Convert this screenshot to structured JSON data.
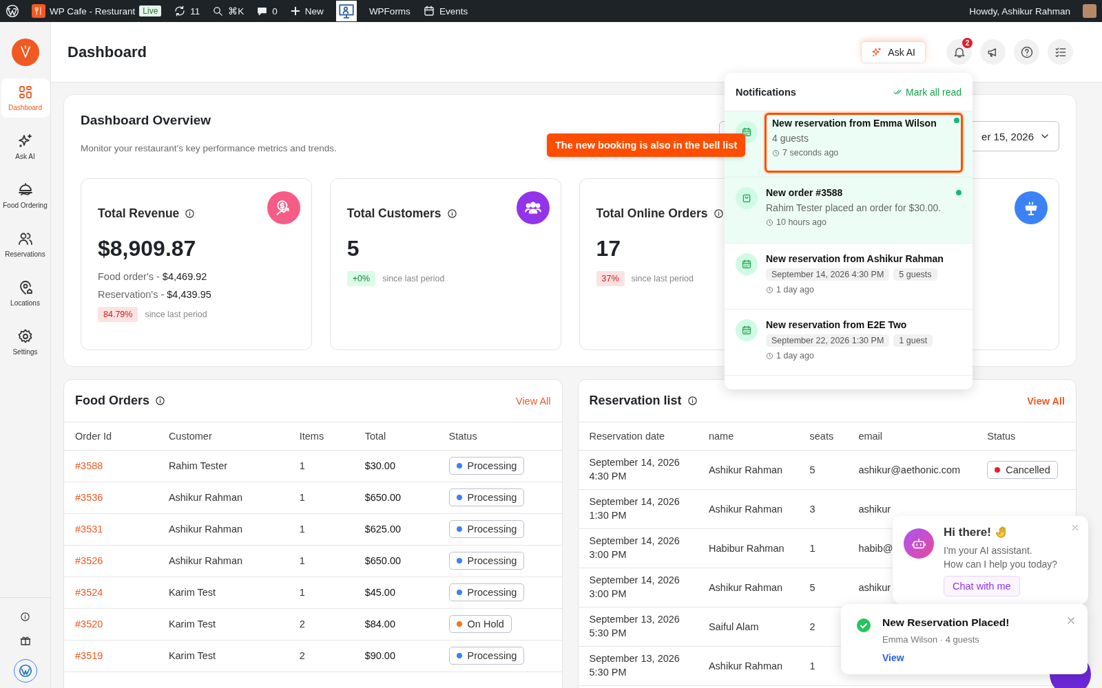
{
  "top_bar": {
    "site_name": "WP Cafe - Resturant",
    "live_badge": "Live",
    "updates": "11",
    "search_shortcut": "⌘K",
    "comments": "0",
    "new_label": "New",
    "links": [
      "WPForms",
      "Events"
    ],
    "greeting": "Howdy, Ashikur Rahman"
  },
  "sidebar": {
    "items": [
      {
        "kind": "dashboard",
        "label": "Dashboard",
        "selected": true
      },
      {
        "kind": "ai",
        "label": "Ask AI",
        "selected": false
      },
      {
        "kind": "food",
        "label": "Food Ordering",
        "selected": false
      },
      {
        "kind": "reservations",
        "label": "Reservations",
        "selected": false
      },
      {
        "kind": "locations",
        "label": "Locations",
        "selected": false
      },
      {
        "kind": "settings",
        "label": "Settings",
        "selected": false
      }
    ]
  },
  "header": {
    "title": "Dashboard",
    "ask_ai": "Ask AI",
    "notification_count": "2"
  },
  "overview": {
    "title": "Dashboard Overview",
    "subtitle": "Monitor your restaurant's key performance metrics and trends.",
    "date_range": "er 15, 2026",
    "stats": [
      {
        "kind": "revenue",
        "title": "Total Revenue",
        "value": "$8,909.87",
        "breakdown": [
          {
            "label": "Food order's -",
            "amount": "$4,469.92"
          },
          {
            "label": "Reservation's -",
            "amount": "$4,439.95"
          }
        ],
        "change": "84.79%",
        "positive": false,
        "note": "since last period",
        "color": "#f75c86"
      },
      {
        "kind": "customers",
        "title": "Total Customers",
        "value": "5",
        "change": "+0%",
        "positive": true,
        "note": "since last period",
        "color": "#9333ea"
      },
      {
        "title": "Total Online Orders",
        "value": "17",
        "change": "37%",
        "positive": false,
        "note": "since last period"
      },
      {
        "kind": "reservations",
        "color": "#3b82f6"
      }
    ]
  },
  "food_orders": {
    "title": "Food Orders",
    "view_all": "View All",
    "columns": [
      "Order Id",
      "Customer",
      "Items",
      "Total",
      "Status"
    ],
    "rows": [
      {
        "id": "#3588",
        "customer": "Rahim Tester",
        "items": "1",
        "total": "$30.00",
        "status": {
          "label": "Processing",
          "color": "#3b82f6"
        }
      },
      {
        "id": "#3536",
        "customer": "Ashikur Rahman",
        "items": "1",
        "total": "$650.00",
        "status": {
          "label": "Processing",
          "color": "#3b82f6"
        }
      },
      {
        "id": "#3531",
        "customer": "Ashikur Rahman",
        "items": "1",
        "total": "$625.00",
        "status": {
          "label": "Processing",
          "color": "#3b82f6"
        }
      },
      {
        "id": "#3526",
        "customer": "Ashikur Rahman",
        "items": "1",
        "total": "$650.00",
        "status": {
          "label": "Processing",
          "color": "#3b82f6"
        }
      },
      {
        "id": "#3524",
        "customer": "Karim Test",
        "items": "1",
        "total": "$45.00",
        "status": {
          "label": "Processing",
          "color": "#3b82f6"
        }
      },
      {
        "id": "#3520",
        "customer": "Karim Test",
        "items": "2",
        "total": "$84.00",
        "status": {
          "label": "On Hold",
          "color": "#f97316"
        }
      },
      {
        "id": "#3519",
        "customer": "Karim Test",
        "items": "2",
        "total": "$90.00",
        "status": {
          "label": "Processing",
          "color": "#3b82f6"
        }
      }
    ]
  },
  "reservations": {
    "title": "Reservation list",
    "view_all": "View All",
    "columns": [
      "Reservation date",
      "name",
      "seats",
      "email",
      "Status"
    ],
    "rows": [
      {
        "date": "September 14, 2026",
        "time": "4:30 PM",
        "name": "Ashikur Rahman",
        "seats": "5",
        "email": "ashikur@aethonic.com",
        "status": {
          "label": "Cancelled",
          "color": "#ef1c2c"
        }
      },
      {
        "date": "September 14, 2026",
        "time": "1:30 PM",
        "name": "Ashikur Rahman",
        "seats": "3",
        "email": "ashikur"
      },
      {
        "date": "September 14, 2026",
        "time": "3:00 PM",
        "name": "Habibur Rahman",
        "seats": "1",
        "email": "habib@"
      },
      {
        "date": "September 14, 2026",
        "time": "3:00 PM",
        "name": "Ashikur Rahman",
        "seats": "5",
        "email": "ashikur"
      },
      {
        "date": "September 13, 2026",
        "time": "5:30 PM",
        "name": "Saiful Alam",
        "seats": "2"
      },
      {
        "date": "September 13, 2026",
        "time": "5:30 PM",
        "name": "Ashikur Rahman",
        "seats": "1"
      }
    ]
  },
  "notifications": {
    "title": "Notifications",
    "mark_all_read": "Mark all read",
    "items": [
      {
        "kind": "reservation",
        "title": "New reservation from Emma Wilson",
        "detail": "4 guests",
        "time": "7 seconds ago",
        "unread": true,
        "highlighted": true
      },
      {
        "kind": "order",
        "title": "New order #3588",
        "detail": "Rahim Tester placed an order for $30.00.",
        "time": "10 hours ago",
        "unread": true,
        "highlighted": false
      },
      {
        "kind": "reservation",
        "title": "New reservation from Ashikur Rahman",
        "chips": [
          "September 14, 2026 4:30 PM",
          "5 guests"
        ],
        "time": "1 day ago",
        "unread": false,
        "highlighted": false
      },
      {
        "kind": "reservation",
        "title": "New reservation from E2E Two",
        "chips": [
          "September 22, 2026 1:30 PM",
          "1 guest"
        ],
        "time": "1 day ago",
        "unread": false,
        "highlighted": false
      }
    ]
  },
  "callout": {
    "text": "The new booking is also in the bell list"
  },
  "assistant": {
    "greeting": "Hi there!",
    "message_lines": [
      "I'm your AI assistant.",
      "How can I help you today?"
    ],
    "button": "Chat with me"
  },
  "toast": {
    "title": "New Reservation Placed!",
    "detail": "Emma Wilson · 4 guests",
    "action": "View"
  }
}
